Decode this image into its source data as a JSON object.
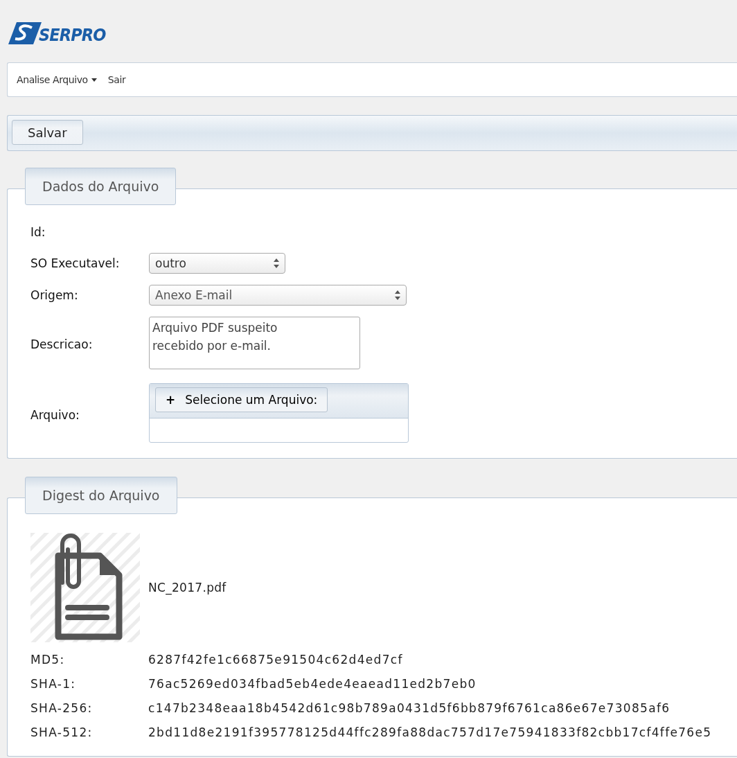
{
  "logo": {
    "text": "SERPRO"
  },
  "menu": [
    {
      "label": "Analise Arquivo",
      "kind": "dropdown"
    },
    {
      "label": "Sair",
      "kind": "link"
    }
  ],
  "toolbar": {
    "buttons": [
      "Salvar"
    ]
  },
  "dados": {
    "legend": "Dados do Arquivo",
    "fields": [
      {
        "label": "Id:",
        "kind": "text"
      },
      {
        "label": "SO Executavel:",
        "kind": "select",
        "value": "outro"
      },
      {
        "label": "Origem:",
        "kind": "select",
        "value": "Anexo E-mail"
      },
      {
        "label": "Descricao:",
        "kind": "textarea",
        "value": "Arquivo PDF suspeito\nrecebido por e-mail."
      },
      {
        "label": "Arquivo:",
        "kind": "upload",
        "button": "Selecione um Arquivo:",
        "plus": "+"
      }
    ]
  },
  "digest": {
    "legend": "Digest do Arquivo",
    "file_name": "NC_2017.pdf",
    "hashes": [
      {
        "label": "MD5:",
        "value": "6287f42fe1c66875e91504c62d4ed7cf"
      },
      {
        "label": "SHA-1:",
        "value": "76ac5269ed034fbad5eb4ede4eaead11ed2b7eb0"
      },
      {
        "label": "SHA-256:",
        "value": "c147b2348eaa18b4542d61c98b789a0431d5f6bb879f6761ca86e67e73085af6"
      },
      {
        "label": "SHA-512:",
        "value": "2bd11d8e2191f395778125d44ffc289fa88dac757d17e75941833f82cbb17cf4ffe76e5"
      }
    ]
  }
}
